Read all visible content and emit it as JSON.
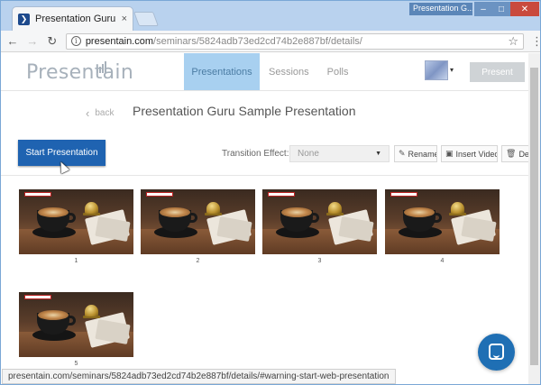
{
  "browser": {
    "tab_title": "Presentation Guru Samp",
    "tab_close": "×",
    "window_label": "Presentation G...",
    "win_min": "–",
    "win_max": "□",
    "win_close": "✕",
    "back_arrow": "←",
    "forward_arrow": "→",
    "reload": "↻",
    "url_host": "presentain.com",
    "url_path": "/seminars/5824adb73ed2cd74b2e887bf/details/",
    "star": "☆",
    "menu": "⋮",
    "status_url": "presentain.com/seminars/5824adb73ed2cd74b2e887bf/details/#warning-start-web-presentation"
  },
  "app": {
    "logo": "Presentain",
    "nav": [
      {
        "label": "Presentations",
        "active": true
      },
      {
        "label": "Sessions",
        "active": false
      },
      {
        "label": "Polls",
        "active": false
      }
    ],
    "present_label": "Present",
    "avatar_caret": "▾"
  },
  "details": {
    "back_label": "back",
    "back_chevron": "‹",
    "title": "Presentation Guru Sample Presentation",
    "start_label": "Start Presentation",
    "transition_label": "Transition Effect:",
    "transition_value": "None",
    "select_caret": "▼",
    "rename_label": "Rename",
    "insert_video_label": "Insert Video",
    "delete_label": "Dele",
    "icons": {
      "rename": "✎",
      "insert_video": "▣",
      "delete": "🗑"
    }
  },
  "slides": [
    {
      "number": "1"
    },
    {
      "number": "2"
    },
    {
      "number": "3"
    },
    {
      "number": "4"
    },
    {
      "number": "5"
    }
  ]
}
